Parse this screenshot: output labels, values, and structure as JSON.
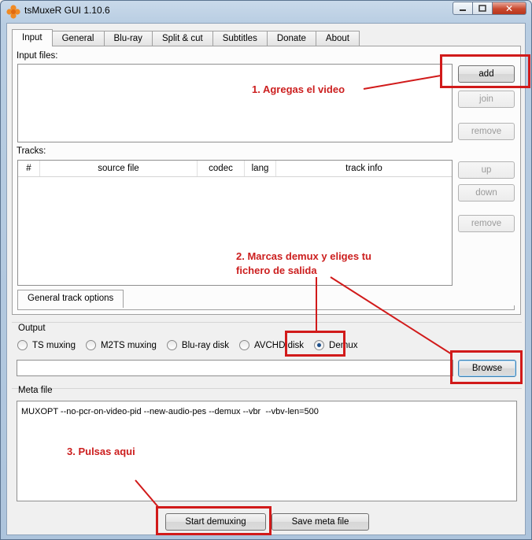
{
  "window": {
    "title": "tsMuxeR GUI 1.10.6"
  },
  "tabs": [
    "Input",
    "General",
    "Blu-ray",
    "Split & cut",
    "Subtitles",
    "Donate",
    "About"
  ],
  "input": {
    "input_files_label": "Input files:",
    "tracks_label": "Tracks:",
    "buttons": {
      "add": "add",
      "join": "join",
      "remove_files": "remove",
      "up": "up",
      "down": "down",
      "remove_tracks": "remove"
    },
    "columns": [
      "#",
      "source file",
      "codec",
      "lang",
      "track info"
    ],
    "general_track_options": "General track options"
  },
  "output": {
    "label": "Output",
    "options": [
      "TS muxing",
      "M2TS muxing",
      "Blu-ray disk",
      "AVCHD disk",
      "Demux"
    ],
    "selected": "Demux",
    "path_value": "",
    "browse": "Browse"
  },
  "meta": {
    "label": "Meta file",
    "text": "MUXOPT --no-pcr-on-video-pid --new-audio-pes --demux --vbr  --vbv-len=500"
  },
  "actions": {
    "start": "Start demuxing",
    "save_meta": "Save meta file"
  },
  "annotations": {
    "step1": "1. Agregas el video",
    "step2_line1": "2. Marcas demux y eliges tu",
    "step2_line2": "fichero de salida",
    "step3": "3. Pulsas aqui",
    "color": "#cc1f1f"
  }
}
